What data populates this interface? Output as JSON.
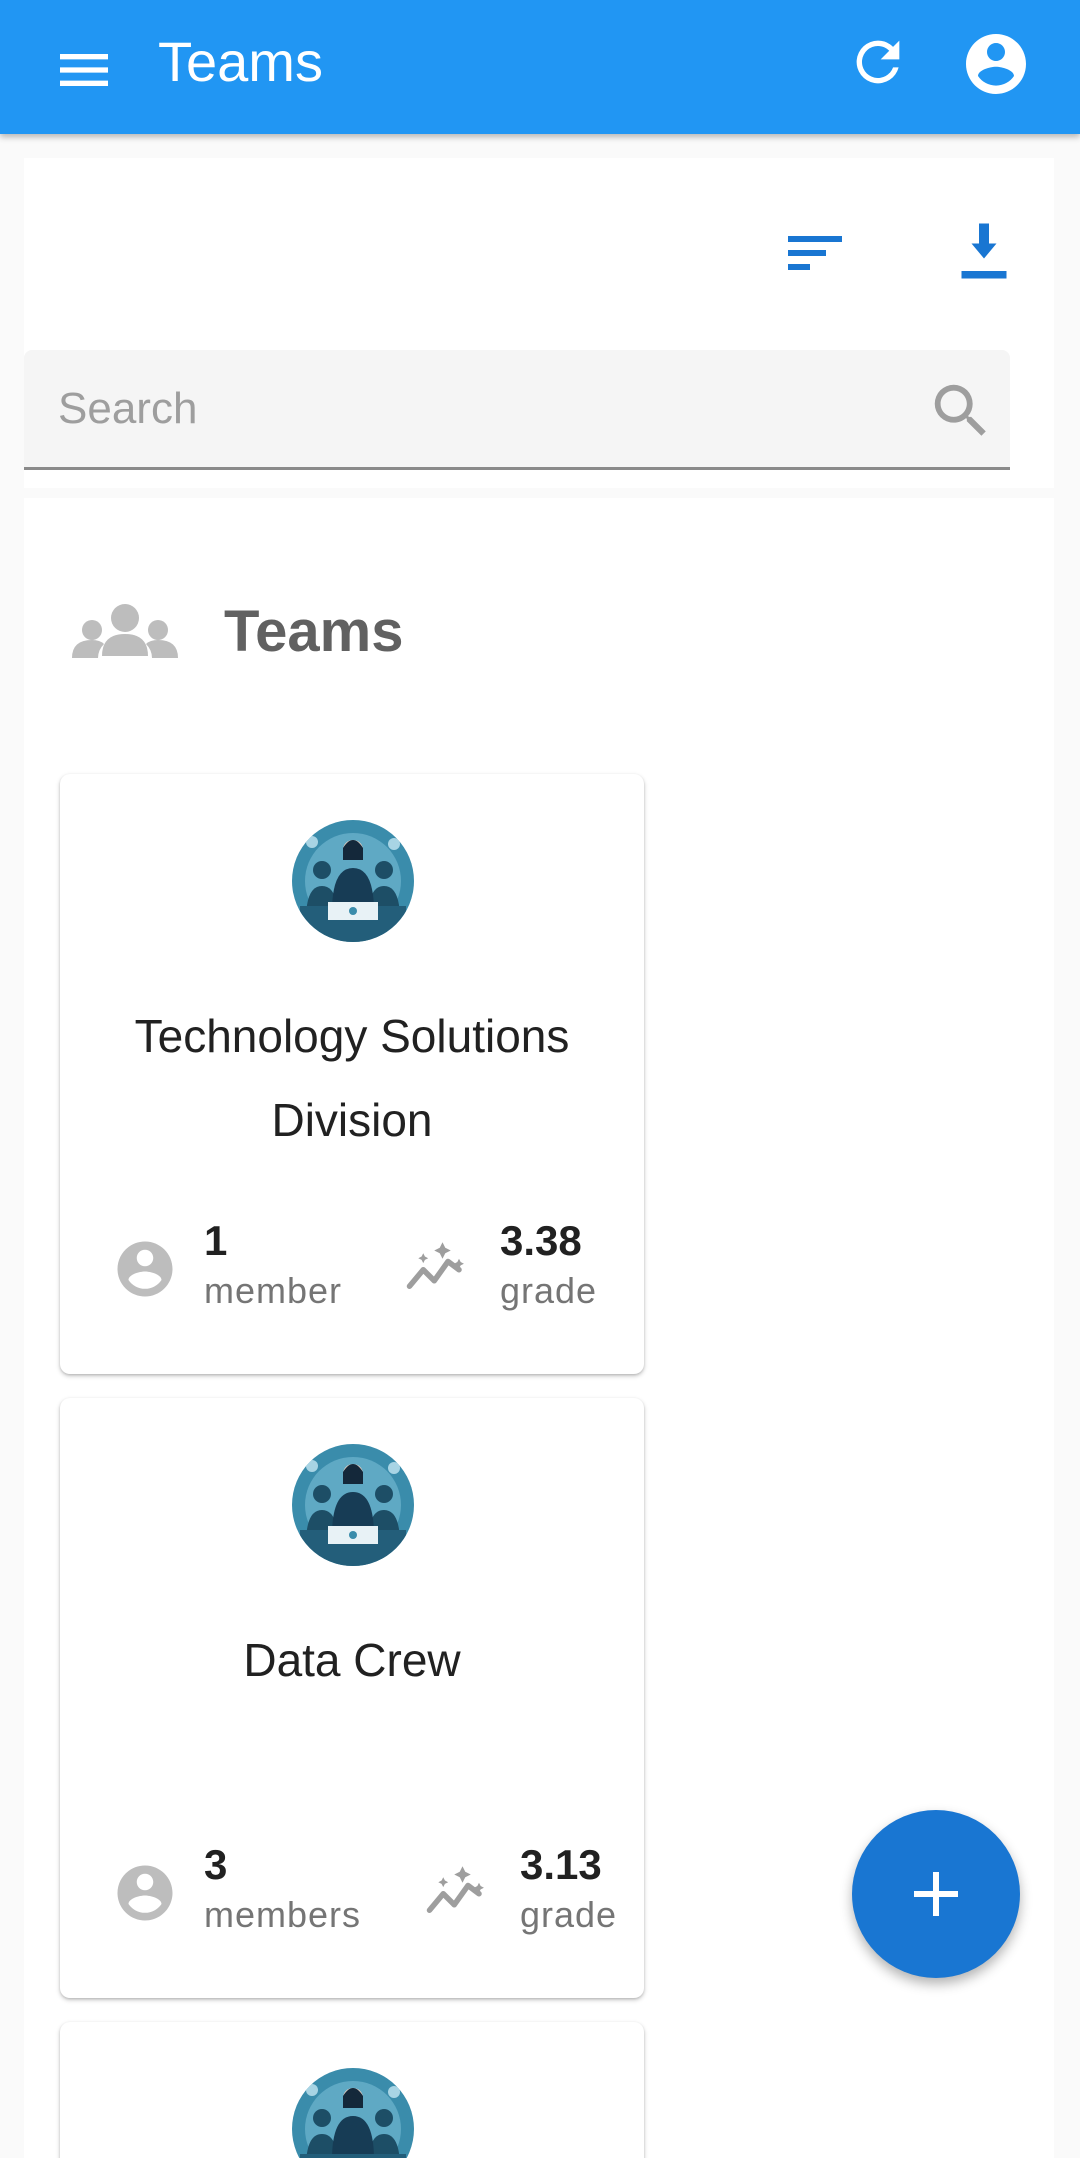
{
  "appbar": {
    "title": "Teams",
    "background_color": "#2196f3",
    "icons": {
      "menu": "menu-icon",
      "refresh": "refresh-icon",
      "account": "account-circle-icon"
    }
  },
  "toolbar": {
    "icons": {
      "sort": "sort-icon",
      "download": "download-icon"
    },
    "accent_color": "#1976d2"
  },
  "search": {
    "placeholder": "Search",
    "value": "",
    "icon": "search-icon"
  },
  "section": {
    "title": "Teams",
    "icon": "groups-icon"
  },
  "teams": [
    {
      "name": "Technology Solutions Division",
      "members_value": "1",
      "members_label": "member",
      "grade_value": "3.38",
      "grade_label": "grade"
    },
    {
      "name": "Data Crew",
      "members_value": "3",
      "members_label": "members",
      "grade_value": "3.13",
      "grade_label": "grade"
    }
  ],
  "fab": {
    "icon": "add-icon",
    "color": "#1976d2"
  }
}
